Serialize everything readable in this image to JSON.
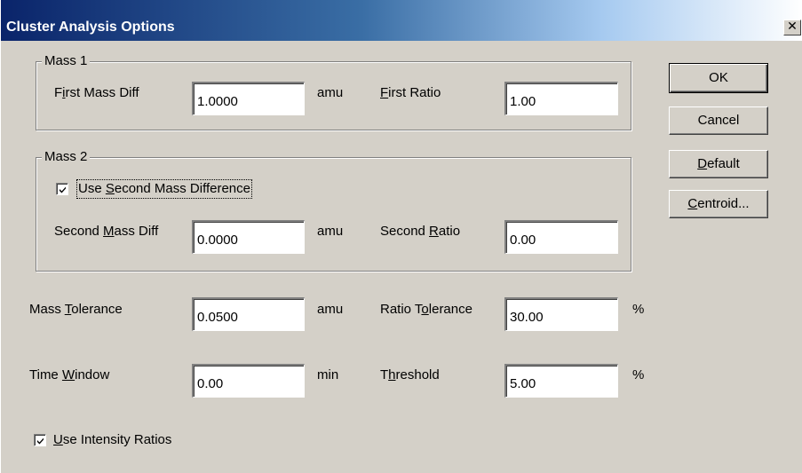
{
  "window": {
    "title": "Cluster Analysis Options",
    "close_glyph": "✕"
  },
  "mass1": {
    "group_label": "Mass 1",
    "first_mass_diff_label": [
      "F",
      "i",
      "rst Mass Diff"
    ],
    "first_mass_diff_value": "1.0000",
    "first_mass_diff_unit": "amu",
    "first_ratio_label": [
      "",
      "F",
      "irst Ratio"
    ],
    "first_ratio_value": "1.00"
  },
  "mass2": {
    "group_label": "Mass 2",
    "use_second_label": [
      "Use ",
      "S",
      "econd Mass Difference"
    ],
    "use_second_checked": true,
    "second_mass_diff_label": [
      "Second ",
      "M",
      "ass Diff"
    ],
    "second_mass_diff_value": "0.0000",
    "second_mass_diff_unit": "amu",
    "second_ratio_label": [
      "Second ",
      "R",
      "atio"
    ],
    "second_ratio_value": "0.00"
  },
  "tolerance": {
    "mass_tol_label": [
      "Mass ",
      "T",
      "olerance"
    ],
    "mass_tol_value": "0.0500",
    "mass_tol_unit": "amu",
    "ratio_tol_label": [
      "Ratio T",
      "o",
      "lerance"
    ],
    "ratio_tol_value": "30.00",
    "ratio_tol_unit": "%"
  },
  "time": {
    "time_window_label": [
      "Time ",
      "W",
      "indow"
    ],
    "time_window_value": "0.00",
    "time_window_unit": "min",
    "threshold_label": [
      "T",
      "h",
      "reshold"
    ],
    "threshold_value": "5.00",
    "threshold_unit": "%"
  },
  "intensity": {
    "use_intensity_label": [
      "",
      "U",
      "se Intensity Ratios"
    ],
    "use_intensity_checked": true
  },
  "buttons": {
    "ok": [
      "",
      "",
      "OK"
    ],
    "cancel": [
      "",
      "",
      "Cancel"
    ],
    "default": [
      "",
      "D",
      "efault"
    ],
    "centroid": [
      "",
      "C",
      "entroid..."
    ]
  },
  "colors": {
    "face": "#d4d0c8",
    "title_start": "#0a246a",
    "title_end": "#ffffff"
  }
}
